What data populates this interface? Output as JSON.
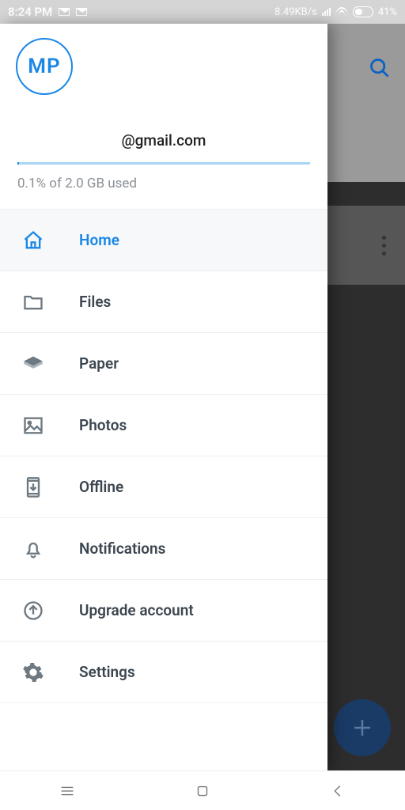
{
  "status": {
    "time": "8:24 PM",
    "net_speed": "8.49KB/s",
    "battery": "41%"
  },
  "drawer": {
    "avatar_initials": "MP",
    "email": "@gmail.com",
    "usage_text": "0.1% of 2.0 GB used",
    "menu": {
      "home": "Home",
      "files": "Files",
      "paper": "Paper",
      "photos": "Photos",
      "offline": "Offline",
      "notifications": "Notifications",
      "upgrade": "Upgrade account",
      "settings": "Settings"
    }
  },
  "colors": {
    "accent": "#1a87e6",
    "fab": "#1a3b66"
  }
}
